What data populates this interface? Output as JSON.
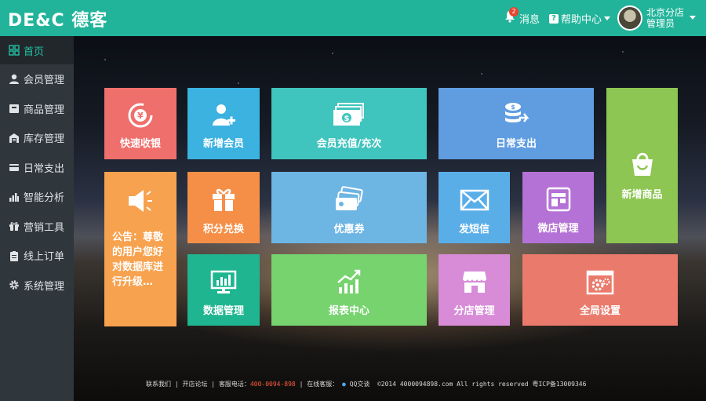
{
  "header": {
    "logo": "DE&C 德客",
    "message_count": "2",
    "messages_label": "消息",
    "help_label": "帮助中心",
    "user_line1": "北京分店",
    "user_line2": "管理员"
  },
  "sidebar": {
    "items": [
      {
        "label": "首页",
        "icon": "grid-icon",
        "active": true
      },
      {
        "label": "会员管理",
        "icon": "user-icon"
      },
      {
        "label": "商品管理",
        "icon": "box-icon"
      },
      {
        "label": "库存管理",
        "icon": "warehouse-icon"
      },
      {
        "label": "日常支出",
        "icon": "card-icon"
      },
      {
        "label": "智能分析",
        "icon": "bar-chart-icon"
      },
      {
        "label": "营销工具",
        "icon": "gift-icon"
      },
      {
        "label": "线上订单",
        "icon": "clipboard-icon"
      },
      {
        "label": "系统管理",
        "icon": "gear-icon"
      }
    ]
  },
  "tiles": {
    "quick_cashier": "快速收银",
    "add_member": "新增会员",
    "member_recharge": "会员充值/充次",
    "daily_expense": "日常支出",
    "add_product": "新增商品",
    "notice": "公告：尊敬的用户您好对数据库进行升级…",
    "points_exchange": "积分兑换",
    "coupon": "优惠券",
    "sms": "发短信",
    "micro_store": "微店管理",
    "data_manage": "数据管理",
    "report_center": "报表中心",
    "branch_manage": "分店管理",
    "global_settings": "全局设置"
  },
  "footer": {
    "contact": "联系我们",
    "forum": "开店论坛",
    "service_phone_label": "客服电话：",
    "service_phone": "400-0094-898",
    "online_service_label": "在线客服：",
    "qq": "QQ交谈",
    "copyright": "©2014 4000094898.com All rights reserved 粤ICP备13009346"
  },
  "colors": {
    "header": "#22b49a",
    "sidebar": "#2f363c",
    "active": "#22c1a3",
    "tile_cashier": "#ef6f6c",
    "tile_member": "#3bb2e0",
    "tile_recharge": "#3fc4be",
    "tile_expense": "#5f9de0",
    "tile_product": "#8dc652",
    "tile_notice": "#f7a24f",
    "tile_points": "#f58f47",
    "tile_coupon": "#6db5e3",
    "tile_sms": "#5aaee8",
    "tile_microstore": "#b472d6",
    "tile_data": "#1fb590",
    "tile_report": "#76d36e",
    "tile_branch": "#d88cd8",
    "tile_settings": "#ea7b6c"
  }
}
